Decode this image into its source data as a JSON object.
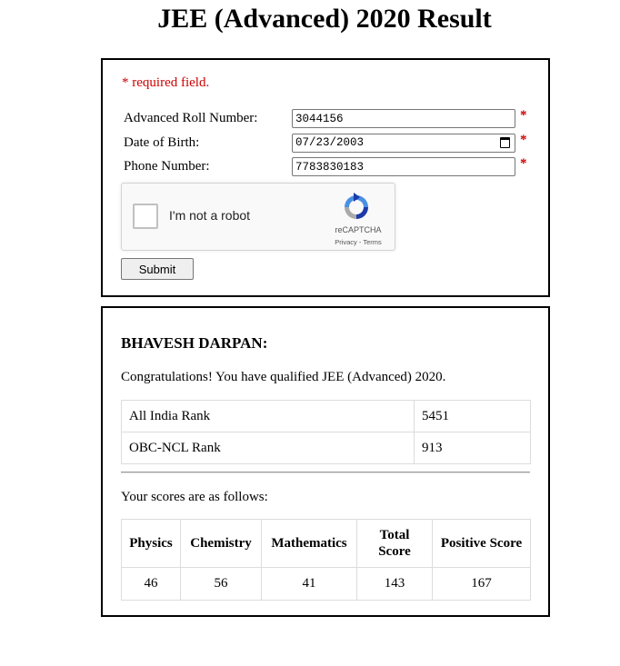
{
  "page": {
    "title": "JEE (Advanced) 2020 Result"
  },
  "form": {
    "required_note": "* required field.",
    "roll": {
      "label": "Advanced Roll Number:",
      "value": "3044156"
    },
    "dob": {
      "label": "Date of Birth:",
      "value": "07/23/2003",
      "icon": "calendar-icon"
    },
    "phone": {
      "label": "Phone Number:",
      "value": "7783830183"
    },
    "required_marker": "*",
    "captcha": {
      "checkbox_label": "I'm not a robot",
      "brand": "reCAPTCHA",
      "privacy": "Privacy",
      "separator": " - ",
      "terms": "Terms",
      "icon": "recaptcha-logo-icon"
    },
    "submit_label": "Submit"
  },
  "result": {
    "candidate_name": "BHAVESH DARPAN:",
    "congrats": "Congratulations! You have qualified JEE (Advanced) 2020.",
    "ranks": [
      {
        "label": "All India Rank",
        "value": "5451"
      },
      {
        "label": "OBC-NCL Rank",
        "value": "913"
      }
    ],
    "scores_intro": "Your scores are as follows:",
    "score_headers": [
      "Physics",
      "Chemistry",
      "Mathematics",
      "Total Score",
      "Positive Score"
    ],
    "score_values": [
      "46",
      "56",
      "41",
      "143",
      "167"
    ]
  },
  "colors": {
    "required": "#cc0000",
    "border": "#000000"
  }
}
